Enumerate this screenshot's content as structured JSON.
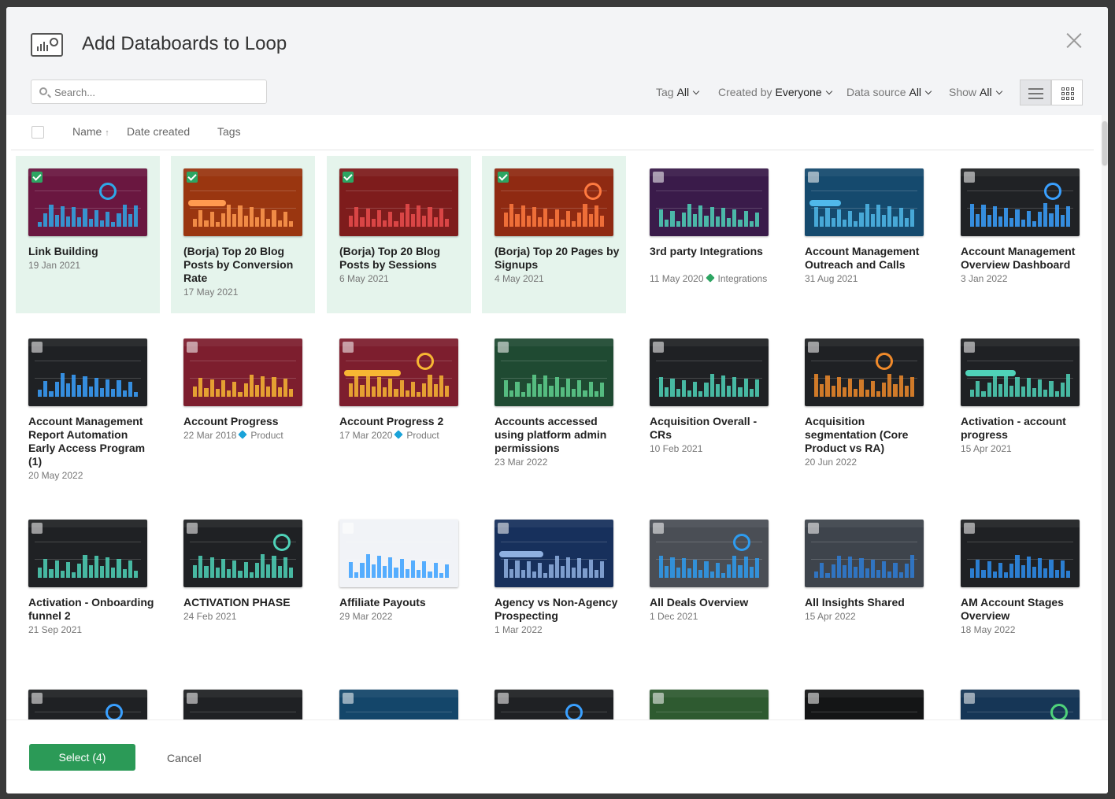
{
  "modal": {
    "title": "Add Databoards to Loop"
  },
  "search": {
    "placeholder": "Search..."
  },
  "filters": [
    {
      "label": "Tag",
      "value": "All"
    },
    {
      "label": "Created by",
      "value": "Everyone"
    },
    {
      "label": "Data source",
      "value": "All"
    },
    {
      "label": "Show",
      "value": "All"
    }
  ],
  "view_toggle": {
    "list_icon": "list-view-icon",
    "grid_icon": "grid-view-icon",
    "active": "grid"
  },
  "columns": {
    "name": "Name",
    "sort_indicator": "↑",
    "date": "Date created",
    "tags": "Tags"
  },
  "tag_colors": {
    "Integrations": "#2da562",
    "Product": "#1aa3d9"
  },
  "databoards": [
    {
      "name": "Link Building",
      "date": "19 Jan 2021",
      "tag": "",
      "selected": true,
      "theme": "#6a1740",
      "accent": "#2ea8e8"
    },
    {
      "name": "(Borja) Top 20 Blog Posts by Conversion Rate",
      "date": "17 May 2021",
      "tag": "",
      "selected": true,
      "theme": "#9a3610",
      "accent": "#ff9a50"
    },
    {
      "name": "(Borja) Top 20 Blog Posts by Sessions",
      "date": "6 May 2021",
      "tag": "",
      "selected": true,
      "theme": "#7e1c1c",
      "accent": "#e94c4c"
    },
    {
      "name": "(Borja) Top 20 Pages by Signups",
      "date": "4 May 2021",
      "tag": "",
      "selected": true,
      "theme": "#8f2a12",
      "accent": "#ff7a40"
    },
    {
      "name": "3rd party Integrations",
      "date": "11 May 2020",
      "tag": "Integrations",
      "selected": false,
      "theme": "#3a1b4a",
      "accent": "#4fd2b8"
    },
    {
      "name": "Account Management Outreach and Calls",
      "date": "31 Aug 2021",
      "tag": "",
      "selected": false,
      "theme": "#154a6e",
      "accent": "#50b8ea"
    },
    {
      "name": "Account Management Overview Dashboard",
      "date": "3 Jan 2022",
      "tag": "",
      "selected": false,
      "theme": "#202225",
      "accent": "#3aa0ff"
    },
    {
      "name": "Account Management Report Automation Early Access Program (1)",
      "date": "20 May 2022",
      "tag": "",
      "selected": false,
      "theme": "#1f2124",
      "accent": "#3aa0ff"
    },
    {
      "name": "Account Progress",
      "date": "22 Mar 2018",
      "tag": "Product",
      "selected": false,
      "theme": "#7d1e2e",
      "accent": "#f7b733"
    },
    {
      "name": "Account Progress 2",
      "date": "17 Mar 2020",
      "tag": "Product",
      "selected": false,
      "theme": "#7d1e2e",
      "accent": "#f7b733"
    },
    {
      "name": "Accounts accessed using platform admin permissions",
      "date": "23 Mar 2022",
      "tag": "",
      "selected": false,
      "theme": "#1f4a32",
      "accent": "#5fd08e"
    },
    {
      "name": "Acquisition Overall - CRs",
      "date": "10 Feb 2021",
      "tag": "",
      "selected": false,
      "theme": "#1f2124",
      "accent": "#4fd2b8"
    },
    {
      "name": "Acquisition segmentation (Core Product vs RA)",
      "date": "20 Jun 2022",
      "tag": "",
      "selected": false,
      "theme": "#1f2124",
      "accent": "#f08a2a"
    },
    {
      "name": "Activation - account progress",
      "date": "15 Apr 2021",
      "tag": "",
      "selected": false,
      "theme": "#1f2124",
      "accent": "#4fd2b8"
    },
    {
      "name": "Activation - Onboarding funnel 2",
      "date": "21 Sep 2021",
      "tag": "",
      "selected": false,
      "theme": "#1f2124",
      "accent": "#4fd2b8"
    },
    {
      "name": "ACTIVATION PHASE",
      "date": "24 Feb 2021",
      "tag": "",
      "selected": false,
      "theme": "#1f2124",
      "accent": "#4fd2b8"
    },
    {
      "name": "Affiliate Payouts",
      "date": "29 Mar 2022",
      "tag": "",
      "selected": false,
      "theme": "#f1f3f7",
      "accent": "#3aa0ff"
    },
    {
      "name": "Agency vs Non-Agency Prospecting",
      "date": "1 Mar 2022",
      "tag": "",
      "selected": false,
      "theme": "#17305c",
      "accent": "#8fb0e0"
    },
    {
      "name": "All Deals Overview",
      "date": "1 Dec 2021",
      "tag": "",
      "selected": false,
      "theme": "#4a4e55",
      "accent": "#2e9cf0"
    },
    {
      "name": "All Insights Shared",
      "date": "15 Apr 2022",
      "tag": "",
      "selected": false,
      "theme": "#3e444c",
      "accent": "#2e7cd6"
    },
    {
      "name": "AM Account Stages Overview",
      "date": "18 May 2022",
      "tag": "",
      "selected": false,
      "theme": "#1f2124",
      "accent": "#2e8ef0"
    },
    {
      "name": "",
      "date": "",
      "tag": "",
      "selected": false,
      "theme": "#1f2124",
      "accent": "#3aa0ff"
    },
    {
      "name": "",
      "date": "",
      "tag": "",
      "selected": false,
      "theme": "#1f2124",
      "accent": "#3aa0ff"
    },
    {
      "name": "",
      "date": "",
      "tag": "",
      "selected": false,
      "theme": "#14466a",
      "accent": "#3aa0ff"
    },
    {
      "name": "",
      "date": "",
      "tag": "",
      "selected": false,
      "theme": "#1f2124",
      "accent": "#3aa0ff"
    },
    {
      "name": "",
      "date": "",
      "tag": "",
      "selected": false,
      "theme": "#2e5a30",
      "accent": "#f06a2a"
    },
    {
      "name": "",
      "date": "",
      "tag": "",
      "selected": false,
      "theme": "#141516",
      "accent": "#3aa0ff"
    },
    {
      "name": "",
      "date": "",
      "tag": "",
      "selected": false,
      "theme": "#163656",
      "accent": "#4fd27a"
    }
  ],
  "footer": {
    "select_label": "Select (4)",
    "cancel_label": "Cancel"
  }
}
